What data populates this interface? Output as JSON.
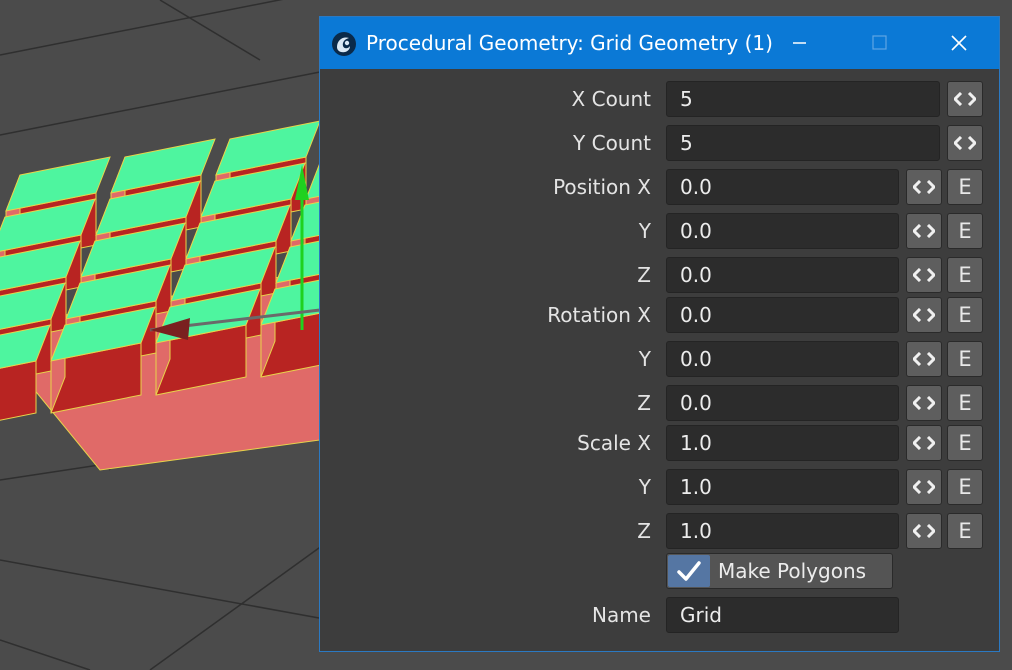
{
  "dialog": {
    "title": "Procedural Geometry: Grid Geometry (1)",
    "accent_color": "#0b79d6"
  },
  "icons": {
    "app": "lightwave-icon",
    "minimize": "minimize-icon",
    "maximize": "maximize-icon",
    "close": "close-icon",
    "arrows": "left-right-arrows-icon",
    "check": "checkmark-icon"
  },
  "fields": {
    "x_count": {
      "label": "X Count",
      "value": "5"
    },
    "y_count": {
      "label": "Y Count",
      "value": "5"
    },
    "position_x": {
      "label": "Position X",
      "value": "0.0"
    },
    "position_y": {
      "label": "Y",
      "value": "0.0"
    },
    "position_z": {
      "label": "Z",
      "value": "0.0"
    },
    "rotation_x": {
      "label": "Rotation X",
      "value": "0.0"
    },
    "rotation_y": {
      "label": "Y",
      "value": "0.0"
    },
    "rotation_z": {
      "label": "Z",
      "value": "0.0"
    },
    "scale_x": {
      "label": "Scale X",
      "value": "1.0"
    },
    "scale_y": {
      "label": "Y",
      "value": "1.0"
    },
    "scale_z": {
      "label": "Z",
      "value": "1.0"
    },
    "name": {
      "label": "Name",
      "value": "Grid"
    }
  },
  "envelope_label": "E",
  "make_polygons": {
    "label": "Make Polygons",
    "checked": true
  },
  "viewport": {
    "top_color": "#4ef59f",
    "side_color": "#e06a68",
    "front_color": "#b82422",
    "gizmo_y_color": "#1fd11f"
  }
}
